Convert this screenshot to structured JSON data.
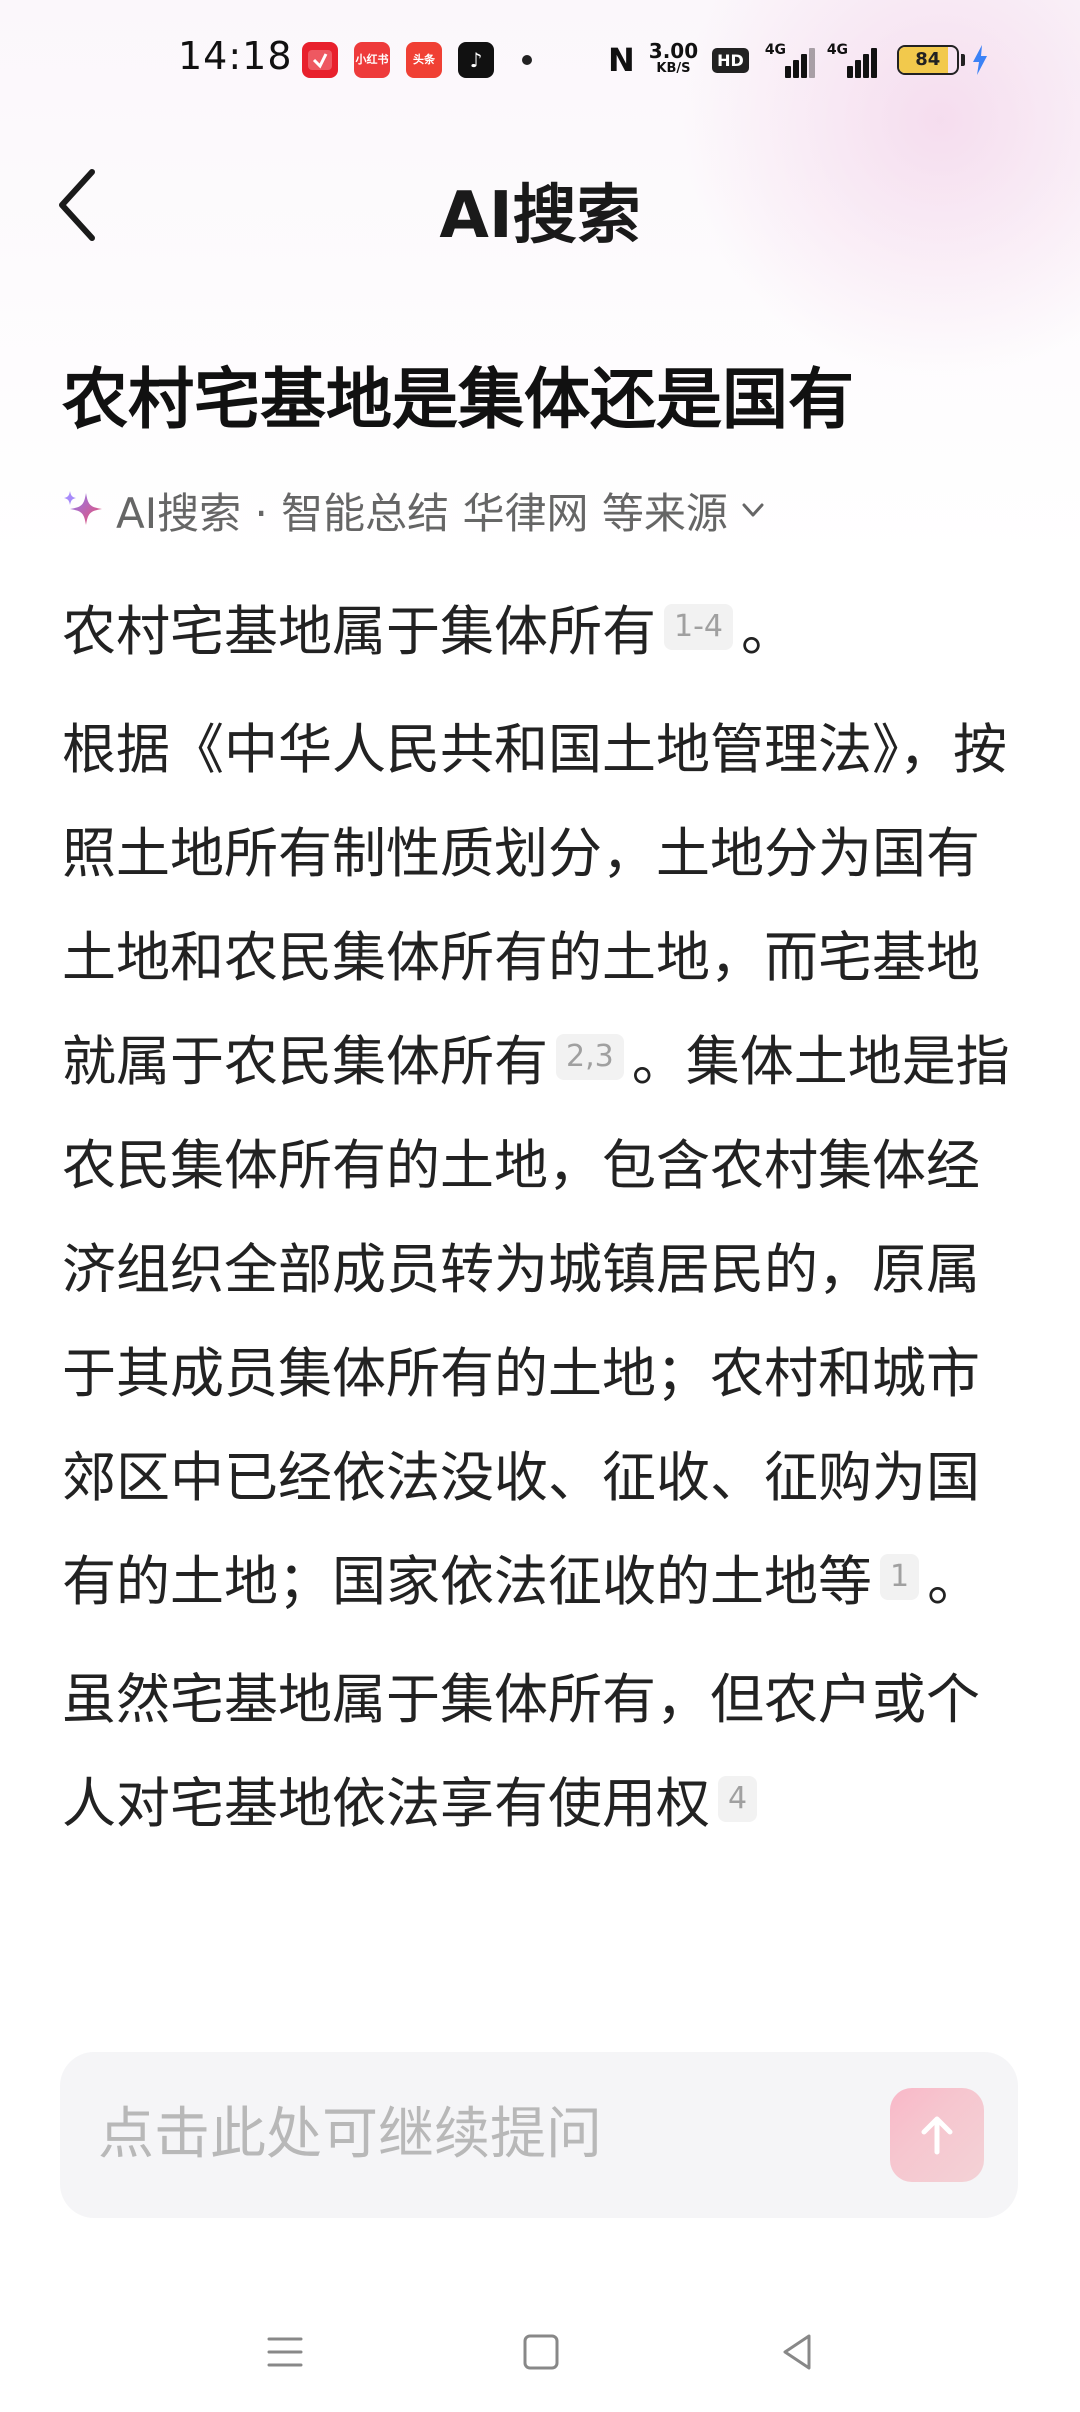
{
  "status_bar": {
    "time": "14:18",
    "apps": [
      "小红书",
      "头条"
    ],
    "net_speed_value": "3.00",
    "net_speed_unit": "KB/S",
    "hd_label": "HD",
    "signal1_label": "4G",
    "signal2_label": "4G",
    "battery_level": "84",
    "battery_fraction": 0.84,
    "icons": [
      "pinduoduo-icon",
      "xiaohongshu-icon",
      "toutiao-icon",
      "douyin-icon",
      "nfc-icon",
      "signal-icon",
      "battery-icon",
      "charging-bolt-icon"
    ]
  },
  "header": {
    "title": "AI搜索",
    "back_icon": "chevron-left-icon"
  },
  "question": {
    "title": "农村宅基地是集体还是国有"
  },
  "source": {
    "prefix": "AI搜索 · 智能总结 华律网 等来源",
    "icon": "sparkle-icon",
    "expand_icon": "chevron-down-icon"
  },
  "answer": {
    "p1_text": "农村宅基地属于集体所有",
    "p1_cite": "1-4",
    "p1_end": "。",
    "p2_text_a": "根据《中华人民共和国土地管理法》，按照土地所有制性质划分，土地分为国有土地和农民集体所有的土地，而宅基地就属于农民集体所有",
    "p2_cite_a": "2,3",
    "p2_text_b": "。集体土地是指农民集体所有的土地，包含农村集体经济组织全部成员转为城镇居民的，原属于其成员集体所有的土地；农村和城市郊区中已经依法没收、征收、征购为国有的土地；国家依法征收的土地等",
    "p2_cite_b": "1",
    "p2_end": "。",
    "p3_text": "虽然宅基地属于集体所有，但农户或个人对宅基地依法享有使用权",
    "p3_cite": "4"
  },
  "composer": {
    "placeholder": "点击此处可继续提问",
    "send_icon": "arrow-up-icon"
  },
  "colors": {
    "accent_pink": "#f7bccb",
    "battery_yellow": "#f2c94c",
    "text_primary": "#222222",
    "text_secondary": "#666666",
    "placeholder": "#b8b8b8"
  },
  "navigation": {
    "icons": [
      "menu-icon",
      "home-square-icon",
      "back-triangle-icon"
    ]
  }
}
